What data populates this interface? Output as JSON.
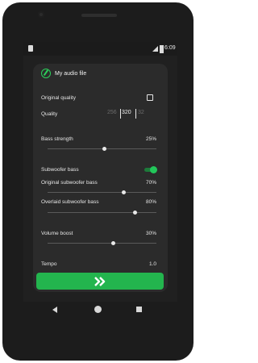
{
  "status_bar": {
    "time": "6:09"
  },
  "file": {
    "label": "My audio file"
  },
  "settings": {
    "original_quality": {
      "label": "Original quality",
      "checked": false
    },
    "quality": {
      "label": "Quality",
      "options": [
        "256",
        "320",
        "32"
      ],
      "selected": "320"
    },
    "bass_strength": {
      "label": "Bass strength",
      "value": "25%",
      "fraction": 0.52
    },
    "subwoofer_bass": {
      "label": "Subwoofer bass",
      "enabled": true
    },
    "original_subwoofer_bass": {
      "label": "Original subwoofer bass",
      "value": "70%",
      "fraction": 0.7
    },
    "overlaid_subwoofer_bass": {
      "label": "Overlaid subwoofer bass",
      "value": "80%",
      "fraction": 0.8
    },
    "volume_boost": {
      "label": "Volume boost",
      "value": "30%",
      "fraction": 0.6
    },
    "tempo": {
      "label": "Tempo",
      "value": "1.0"
    }
  },
  "icons": {
    "file": "audio-file-icon",
    "next": "double-chevron-right-icon",
    "back": "back-triangle-icon",
    "home": "home-circle-icon",
    "recents": "recents-square-icon"
  },
  "colors": {
    "accent": "#23b54e",
    "background": "#202020",
    "card": "#2b2b2b"
  }
}
